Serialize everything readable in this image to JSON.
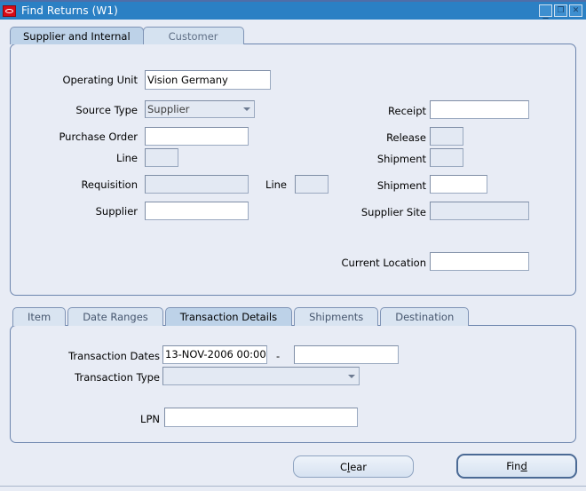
{
  "window": {
    "title": "Find Returns (W1)",
    "logo_icon": "oracle-logo-icon",
    "buttons": {
      "minimize": "minimize-icon",
      "maximize": "maximize-icon",
      "close": "close-icon"
    }
  },
  "top_tabs": [
    {
      "label": "Supplier and Internal",
      "selected": true
    },
    {
      "label": "Customer",
      "selected": false
    }
  ],
  "upper_form": {
    "left_fields": [
      {
        "label": "Operating Unit",
        "value": "Vision Germany",
        "type": "text",
        "enabled": true
      },
      {
        "label": "Source Type",
        "value": "Supplier",
        "type": "combo",
        "enabled": true
      },
      {
        "label": "Purchase Order",
        "value": "",
        "type": "text",
        "enabled": true
      },
      {
        "label": "Line",
        "value": "",
        "type": "text",
        "enabled": false
      },
      {
        "label": "Requisition",
        "value": "",
        "type": "text",
        "enabled": false
      },
      {
        "label": "Supplier",
        "value": "",
        "type": "text",
        "enabled": true
      }
    ],
    "requisition_line": {
      "label": "Line",
      "value": "",
      "enabled": false
    },
    "right_fields": [
      {
        "label": "Receipt",
        "value": "",
        "type": "text",
        "enabled": true
      },
      {
        "label": "Release",
        "value": "",
        "type": "text",
        "enabled": false
      },
      {
        "label": "Shipment",
        "value": "",
        "type": "text",
        "enabled": false
      },
      {
        "label": "Shipment",
        "value": "",
        "type": "text",
        "enabled": true
      },
      {
        "label": "Supplier Site",
        "value": "",
        "type": "text",
        "enabled": false
      },
      {
        "label": "Current Location",
        "value": "",
        "type": "text",
        "enabled": true
      }
    ]
  },
  "bottom_tabs": [
    {
      "label": "Item",
      "selected": false
    },
    {
      "label": "Date Ranges",
      "selected": false
    },
    {
      "label": "Transaction Details",
      "selected": true
    },
    {
      "label": "Shipments",
      "selected": false
    },
    {
      "label": "Destination",
      "selected": false
    }
  ],
  "transaction_details": {
    "dates_label": "Transaction Dates",
    "date_from": "13-NOV-2006 00:00",
    "date_separator": "-",
    "date_to": "",
    "type_label": "Transaction Type",
    "type_value": "",
    "lpn_label": "LPN",
    "lpn_value": ""
  },
  "actions": {
    "clear": {
      "before": "C",
      "mnemonic": "l",
      "after": "ear"
    },
    "find": {
      "before": "Fin",
      "mnemonic": "d",
      "after": ""
    }
  },
  "colors": {
    "titlebar": "#2b80c4",
    "panel_bg": "#e8ecf5",
    "tab_active": "#bdd2e8",
    "tab_inactive": "#d5e2f0",
    "border": "#6b84ad",
    "logo_red": "#d90a16"
  }
}
